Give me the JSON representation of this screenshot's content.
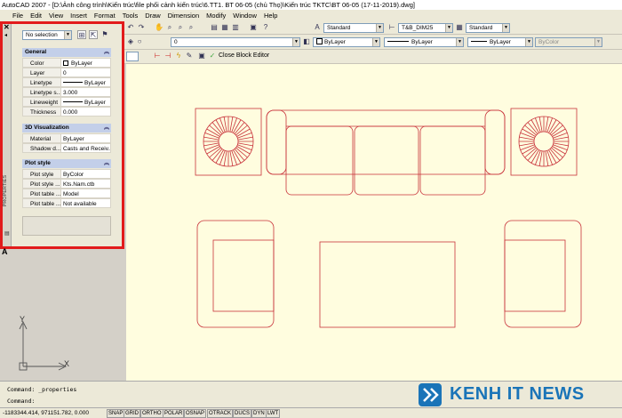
{
  "window": {
    "title": "AutoCAD 2007 - [D:\\Ảnh công trình\\Kiến trúc\\file phối cảnh kiến trúc\\6.TT1. BT 06-05 (chủ Thọ)\\Kiến trúc TKTC\\BT 06-05 (17-11-2019).dwg]"
  },
  "menu": [
    "File",
    "Edit",
    "View",
    "Insert",
    "Format",
    "Tools",
    "Draw",
    "Dimension",
    "Modify",
    "Window",
    "Help"
  ],
  "toolbar_styles": {
    "text_style": "Standard",
    "dim_style": "T&B_DIM25",
    "table_style": "Standard"
  },
  "toolbar_layers": {
    "layer": "0",
    "color": "ByLayer",
    "linetype": "ByLayer",
    "lineweight": "ByLayer",
    "plotstyle": "ByColor"
  },
  "block_editor": {
    "close_label": "Close Block Editor"
  },
  "properties": {
    "selection": "No selection",
    "general": {
      "title": "General",
      "rows": [
        {
          "key": "Color",
          "value": "ByLayer"
        },
        {
          "key": "Layer",
          "value": "0"
        },
        {
          "key": "Linetype",
          "value": "ByLayer"
        },
        {
          "key": "Linetype s...",
          "value": "3.000"
        },
        {
          "key": "Lineweight",
          "value": "ByLayer"
        },
        {
          "key": "Thickness",
          "value": "0.000"
        }
      ]
    },
    "viz": {
      "title": "3D Visualization",
      "rows": [
        {
          "key": "Material",
          "value": "ByLayer"
        },
        {
          "key": "Shadow d...",
          "value": "Casts and Receiv..."
        }
      ]
    },
    "plot": {
      "title": "Plot style",
      "rows": [
        {
          "key": "Plot style",
          "value": "ByColor"
        },
        {
          "key": "Plot style ...",
          "value": "Kts.Nam.ctb"
        },
        {
          "key": "Plot table ...",
          "value": "Model"
        },
        {
          "key": "Plot table ...",
          "value": "Not available"
        }
      ]
    },
    "side_label": "PROPERTIES"
  },
  "ucs": {
    "x": "X",
    "y": "Y"
  },
  "command": {
    "line1": "Command:  _properties",
    "line2": "Command:"
  },
  "status": {
    "coords": "-1183344.414, 971151.782, 0.000",
    "buttons": [
      "SNAP",
      "GRID",
      "ORTHO",
      "POLAR",
      "OSNAP",
      "OTRACK",
      "DUCS",
      "DYN",
      "LWT"
    ]
  },
  "watermark": {
    "text": "KENH IT NEWS"
  },
  "colors": {
    "drawing_bg": "#fffddf",
    "lines": "#c8323a",
    "highlight": "#e21b1b",
    "brand": "#1a74b8"
  }
}
